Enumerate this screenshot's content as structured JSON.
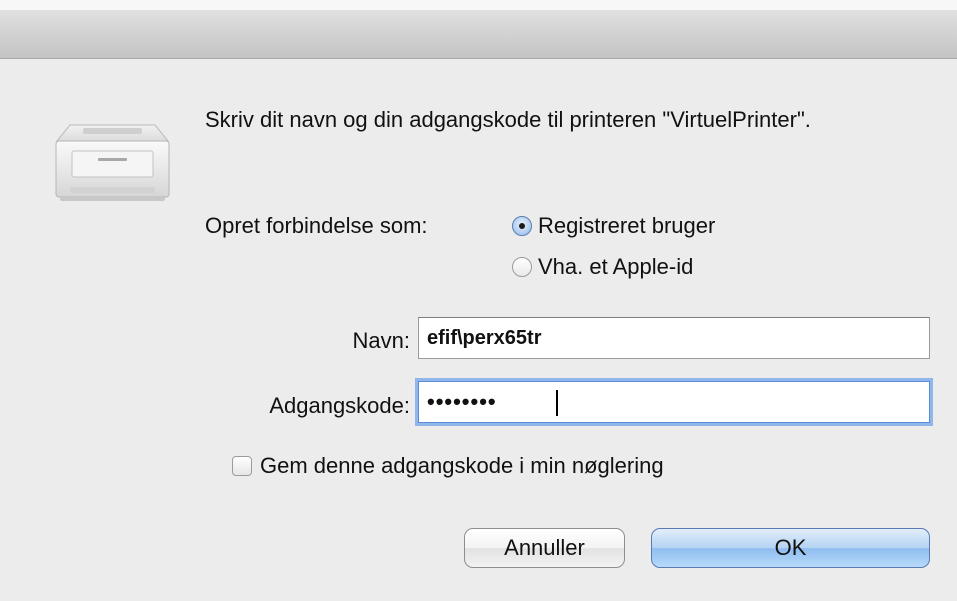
{
  "dialog": {
    "message": "Skriv dit navn og din adgangskode til printeren \"VirtuelPrinter\".",
    "connect_as_label": "Opret forbindelse som:",
    "radio_options": [
      {
        "label": "Registreret bruger",
        "selected": true
      },
      {
        "label": "Vha. et Apple-id",
        "selected": false
      }
    ],
    "name_label": "Navn:",
    "name_value": "efif\\perx65tr",
    "password_label": "Adgangskode:",
    "password_masked": "••••••••",
    "remember_label": "Gem denne adgangskode i min nøglering",
    "remember_checked": false,
    "cancel_label": "Annuller",
    "ok_label": "OK"
  },
  "icons": {
    "printer": "printer-icon"
  },
  "colors": {
    "window_bg": "#ececec",
    "focus_ring": "#8fb7ec",
    "default_button": "#9cc5f2"
  }
}
